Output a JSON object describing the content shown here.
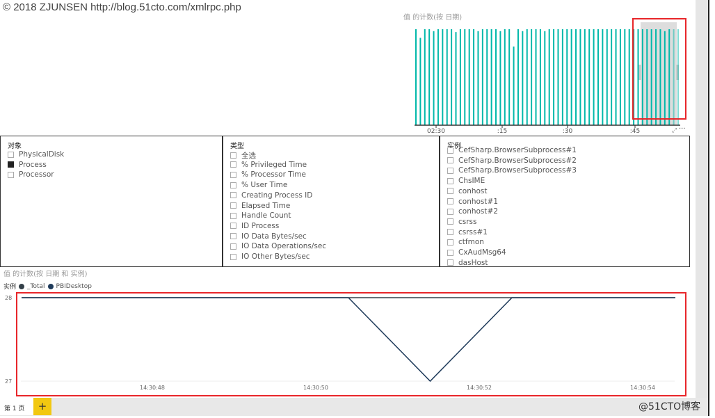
{
  "watermark": "© 2018 ZJUNSEN http://blog.51cto.com/xmlrpc.php",
  "bar_chart": {
    "title": "值 的计数(按 日期)"
  },
  "slicers": [
    {
      "title": "对象",
      "items": [
        {
          "label": "PhysicalDisk",
          "checked": false
        },
        {
          "label": "Process",
          "checked": true
        },
        {
          "label": "Processor",
          "checked": false
        }
      ]
    },
    {
      "title": "类型",
      "items": [
        {
          "label": "全选",
          "checked": false
        },
        {
          "label": "% Privileged Time",
          "checked": false
        },
        {
          "label": "% Processor Time",
          "checked": false
        },
        {
          "label": "% User Time",
          "checked": false
        },
        {
          "label": "Creating Process ID",
          "checked": false
        },
        {
          "label": "Elapsed Time",
          "checked": false
        },
        {
          "label": "Handle Count",
          "checked": false
        },
        {
          "label": "ID Process",
          "checked": false
        },
        {
          "label": "IO Data Bytes/sec",
          "checked": false
        },
        {
          "label": "IO Data Operations/sec",
          "checked": false
        },
        {
          "label": "IO Other Bytes/sec",
          "checked": false
        }
      ]
    },
    {
      "title": "实例",
      "items": [
        {
          "label": "CefSharp.BrowserSubprocess#1",
          "checked": false
        },
        {
          "label": "CefSharp.BrowserSubprocess#2",
          "checked": false
        },
        {
          "label": "CefSharp.BrowserSubprocess#3",
          "checked": false
        },
        {
          "label": "ChsIME",
          "checked": false
        },
        {
          "label": "conhost",
          "checked": false
        },
        {
          "label": "conhost#1",
          "checked": false
        },
        {
          "label": "conhost#2",
          "checked": false
        },
        {
          "label": "csrss",
          "checked": false
        },
        {
          "label": "csrss#1",
          "checked": false
        },
        {
          "label": "ctfmon",
          "checked": false
        },
        {
          "label": "CxAudMsg64",
          "checked": false
        },
        {
          "label": "dasHost",
          "checked": false
        }
      ]
    }
  ],
  "line_chart": {
    "title": "值 的计数(按 日期 和 实例)",
    "legend_title": "实例"
  },
  "chart_data": [
    {
      "type": "bar",
      "title": "值 的计数(按 日期)",
      "x_tick_labels": [
        "02:30",
        ":15",
        ":30",
        ":45"
      ],
      "bar_color": "#01b8aa",
      "values": [
        1.0,
        0.91,
        1.0,
        1.0,
        0.98,
        1.0,
        1.0,
        1.0,
        1.0,
        0.97,
        1.0,
        1.0,
        1.0,
        1.0,
        0.98,
        1.0,
        1.0,
        1.0,
        1.0,
        0.98,
        1.0,
        1.0,
        0.82,
        1.0,
        0.98,
        1.0,
        1.0,
        1.0,
        1.0,
        0.98,
        1.0,
        1.0,
        1.0,
        1.0,
        1.0,
        1.0,
        1.0,
        1.0,
        1.0,
        1.0,
        1.0,
        1.0,
        1.0,
        1.0,
        1.0,
        1.0,
        1.0,
        1.0,
        1.0,
        1.0,
        1.0,
        1.0,
        1.0,
        1.0,
        1.0,
        1.0,
        0.98,
        1.0,
        1.0,
        1.0
      ],
      "selected_range": "last 6 bars"
    },
    {
      "type": "line",
      "title": "值 的计数(按 日期 和 实例)",
      "legend_title": "实例",
      "ylim": [
        27,
        28
      ],
      "y_tick_labels": [
        "28",
        "27"
      ],
      "x_tick_labels": [
        "14:30:48",
        "14:30:50",
        "14:30:52",
        "14:30:54"
      ],
      "x_seconds": [
        46.4,
        47.4,
        48.4,
        49.4,
        50.4,
        51.4,
        52.4,
        53.4,
        54.4
      ],
      "series": [
        {
          "name": "_Total",
          "color": "#333f48",
          "values": [
            28,
            28,
            28,
            28,
            28,
            28,
            28,
            28,
            28
          ]
        },
        {
          "name": "PBIDesktop",
          "color": "#1e3a5a",
          "values": [
            28,
            28,
            28,
            28,
            28,
            27,
            28,
            28,
            28
          ]
        }
      ]
    }
  ],
  "tabs": {
    "page1": "第 1 页",
    "add": "+"
  },
  "logo": "@51CTO博客"
}
